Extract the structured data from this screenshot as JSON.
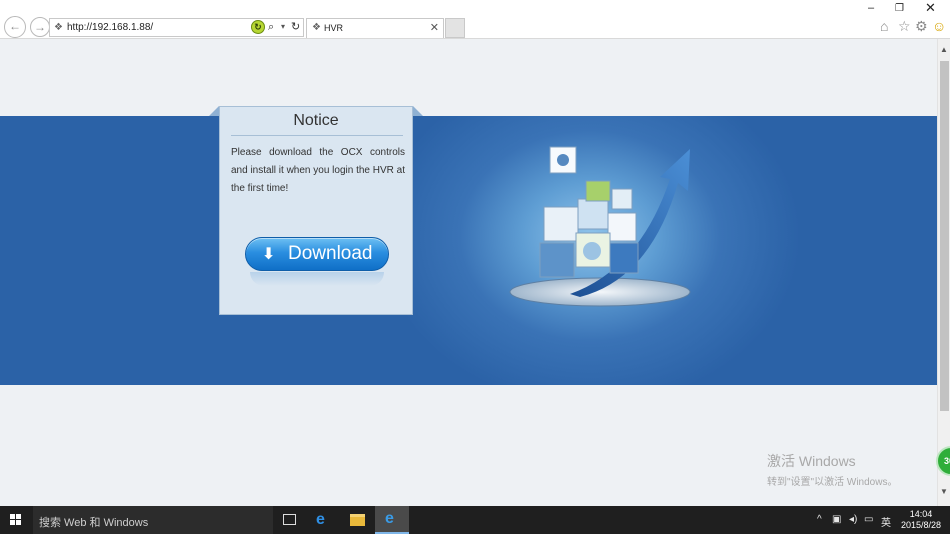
{
  "browser": {
    "url": "http://192.168.1.88/",
    "tab_title": "HVR",
    "close_glyph": "✕",
    "icons": [
      "back-icon",
      "forward-icon",
      "compat-view-icon",
      "search-icon",
      "refresh-icon",
      "home-icon",
      "favorites-star-icon",
      "gear-icon",
      "smiley-icon"
    ]
  },
  "notice": {
    "title": "Notice",
    "message": "Please download the OCX controls and install it when you login the HVR at the first time!",
    "download_label": "Download"
  },
  "watermark": {
    "line1": "激活 Windows",
    "line2": "转到\"设置\"以激活 Windows。"
  },
  "taskbar": {
    "search_placeholder": "搜索 Web 和 Windows",
    "language": "英",
    "time": "14:04",
    "date": "2015/8/28"
  },
  "colors": {
    "band": "#2b62a7",
    "page_bg": "#eef1f4",
    "notice_bg": "#dae6f1",
    "download_btn": "#2a8ee0"
  }
}
